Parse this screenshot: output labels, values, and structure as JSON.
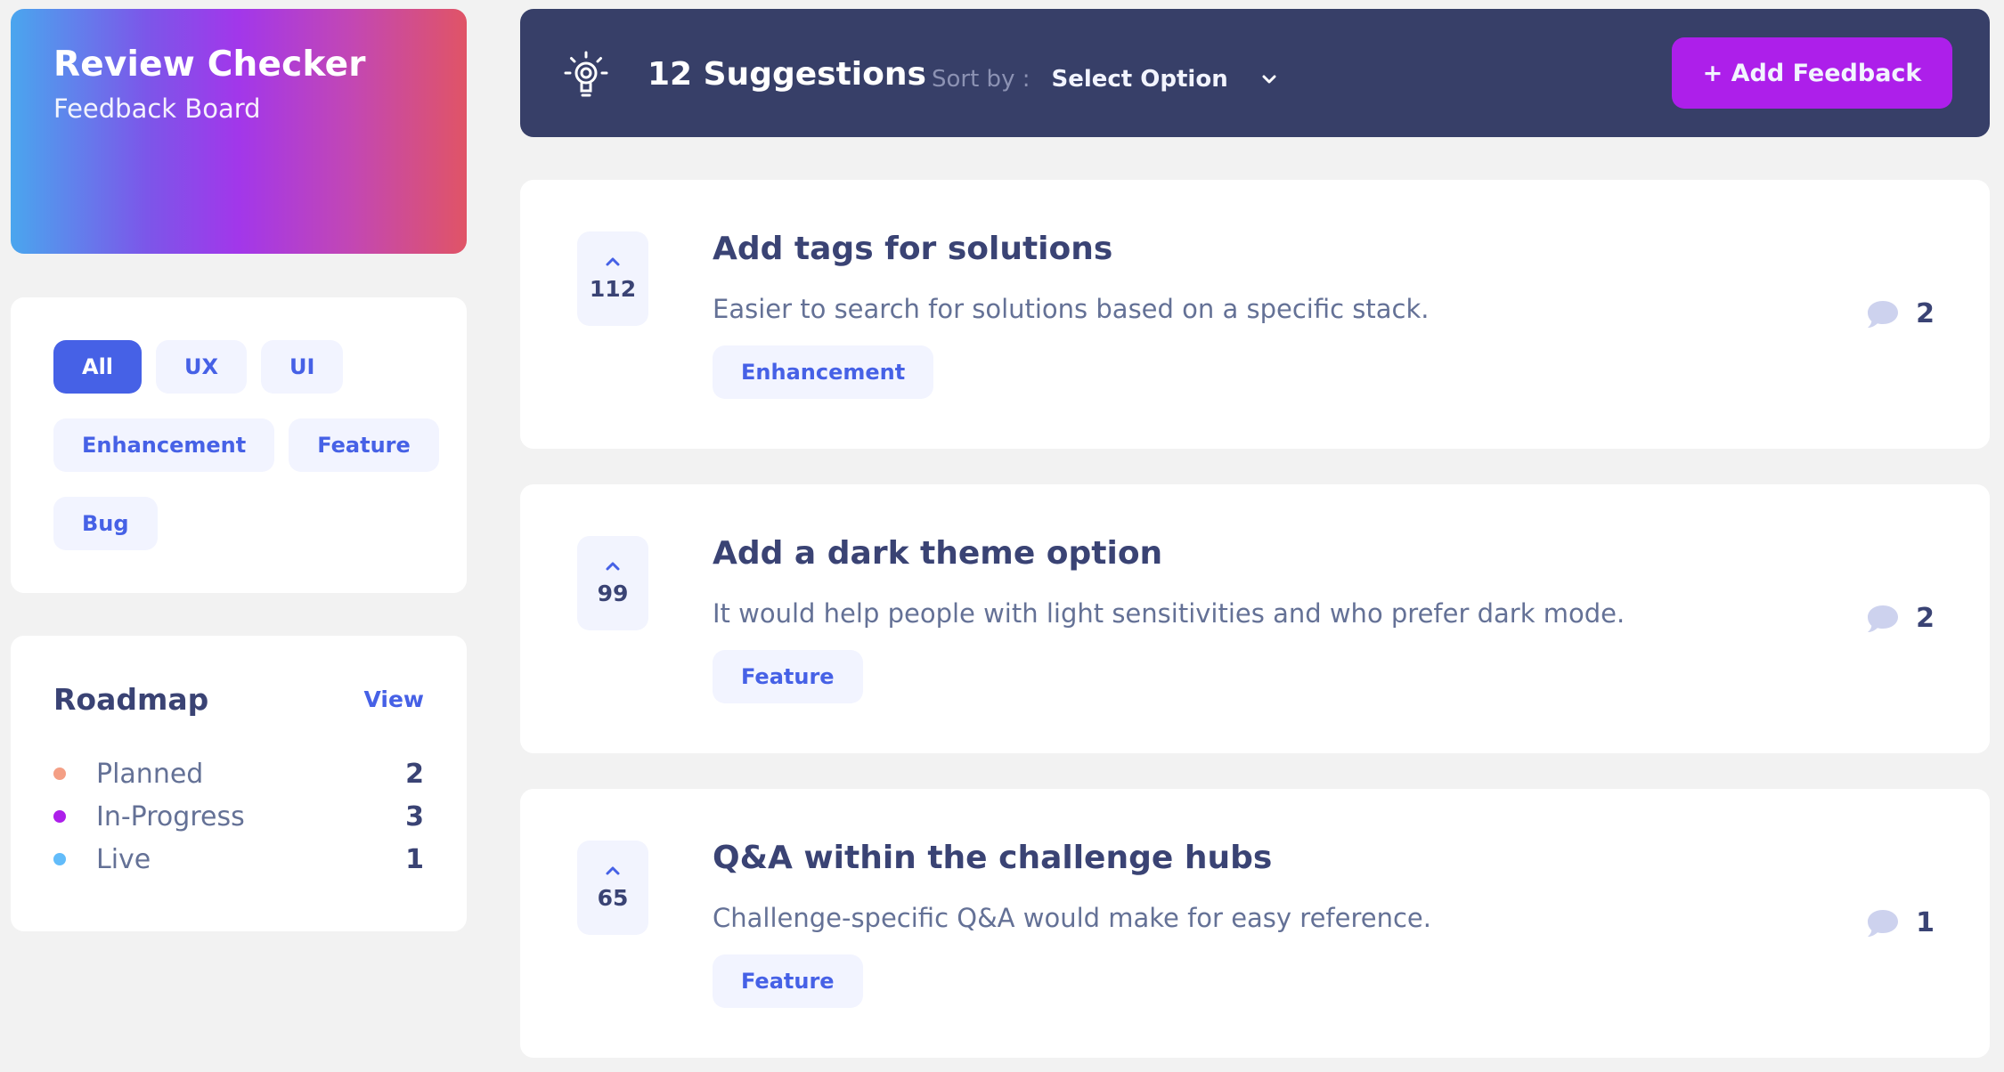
{
  "brand": {
    "title": "Review Checker",
    "subtitle": "Feedback Board"
  },
  "filters": {
    "rows": [
      [
        {
          "label": "All",
          "active": true
        },
        {
          "label": "UX",
          "active": false
        },
        {
          "label": "UI",
          "active": false
        }
      ],
      [
        {
          "label": "Enhancement",
          "active": false
        },
        {
          "label": "Feature",
          "active": false
        }
      ],
      [
        {
          "label": "Bug",
          "active": false
        }
      ]
    ]
  },
  "roadmap": {
    "title": "Roadmap",
    "view_label": "View",
    "items": [
      {
        "label": "Planned",
        "count": "2",
        "color": "#f49f85"
      },
      {
        "label": "In-Progress",
        "count": "3",
        "color": "#ad1fea"
      },
      {
        "label": "Live",
        "count": "1",
        "color": "#62bcfa"
      }
    ]
  },
  "topbar": {
    "icon": "lightbulb-icon",
    "suggestion_count_label": "12 Suggestions",
    "sort_label": "Sort by :",
    "sort_value": "Select Option",
    "add_button_label": "+ Add Feedback"
  },
  "suggestions": [
    {
      "votes": "112",
      "title": "Add tags for solutions",
      "description": "Easier to search for solutions based on a specific stack.",
      "tag": "Enhancement",
      "comments": "2"
    },
    {
      "votes": "99",
      "title": "Add a dark theme option",
      "description": "It would help people with light sensitivities and who prefer dark mode.",
      "tag": "Feature",
      "comments": "2"
    },
    {
      "votes": "65",
      "title": "Q&A within the challenge hubs",
      "description": "Challenge-specific Q&A would make for easy reference.",
      "tag": "Feature",
      "comments": "1"
    }
  ],
  "colors": {
    "accent_blue": "#4661e6",
    "accent_purple": "#ad1fea",
    "dark_navy": "#373f68",
    "text_dark": "#3a4374",
    "text_muted": "#647196",
    "chip_bg": "#f2f4ff",
    "page_bg": "#f2f2f2"
  }
}
